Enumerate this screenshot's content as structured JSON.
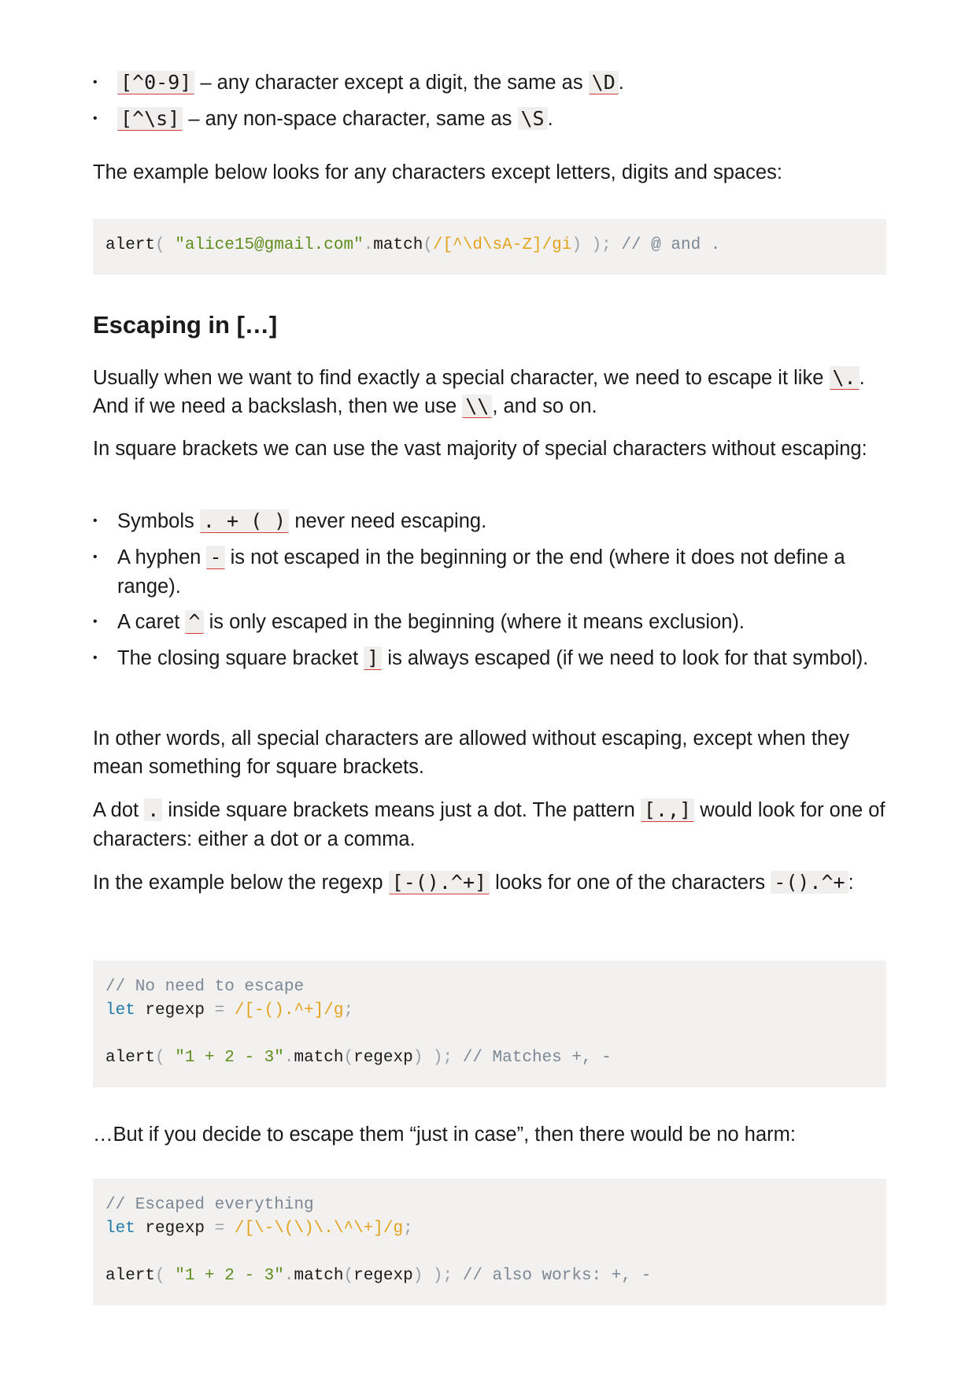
{
  "top_bullets": [
    {
      "code": "[^0-9]",
      "text1": " – any character except a digit, the same as ",
      "code2": "\\D",
      "text2": "."
    },
    {
      "code": "[^\\s]",
      "text1": " – any non-space character, same as ",
      "code2": "\\S",
      "text2": "."
    }
  ],
  "example_intro": "The example below looks for any characters except letters, digits and spaces:",
  "code1": {
    "l1_fn": "alert",
    "l1_p1": "( ",
    "l1_str": "\"alice15@gmail.com\"",
    "l1_dot": ".",
    "l1_m": "match",
    "l1_p2": "(",
    "l1_re": "/[^\\d\\sA-Z]/gi",
    "l1_p3": ") ); ",
    "l1_cm": "// @ and ."
  },
  "heading": "Escaping in […]",
  "para1": {
    "t1": "Usually when we want to find exactly a special character, we need to escape it like ",
    "c1": "\\.",
    "t2": ". And if we need a backslash, then we use ",
    "c2": "\\\\",
    "t3": ", and so on."
  },
  "para2": "In square brackets we can use the vast majority of special characters without escaping:",
  "rules": [
    {
      "t1": "Symbols ",
      "c": ". + ( )",
      "t2": " never need escaping."
    },
    {
      "t1": "A hyphen ",
      "c": "-",
      "t2": " is not escaped in the beginning or the end (where it does not define a range)."
    },
    {
      "t1": "A caret ",
      "c": "^",
      "t2": " is only escaped in the beginning (where it means exclusion)."
    },
    {
      "t1": "The closing square bracket ",
      "c": "]",
      "t2": " is always escaped (if we need to look for that symbol)."
    }
  ],
  "para3": "In other words, all special characters are allowed without escaping, except when they mean something for square brackets.",
  "para4": {
    "t1": "A dot ",
    "c1": ".",
    "t2": " inside square brackets means just a dot. The pattern ",
    "c2": "[.,]",
    "t3": " would look for one of characters: either a dot or a comma."
  },
  "para5": {
    "t1": "In the example below the regexp ",
    "c1": "[-().^+]",
    "t2": " looks for one of the characters ",
    "c2": "-().^+",
    "t3": ":"
  },
  "code2": {
    "comment": "// No need to escape",
    "kw": "let",
    "var": " regexp ",
    "eq": "=",
    "re": " /[-().^+]/g",
    "semi": ";",
    "fn": "alert",
    "p1": "( ",
    "str": "\"1 + 2 - 3\"",
    "dot": ".",
    "m": "match",
    "p2": "(",
    "arg": "regexp",
    "p3": ") ); ",
    "cm": "// Matches +, -"
  },
  "para6": "…But if you decide to escape them “just in case”, then there would be no harm:",
  "code3": {
    "comment": "// Escaped everything",
    "kw": "let",
    "var": " regexp ",
    "eq": "=",
    "re": " /[\\-\\(\\)\\.\\^\\+]/g",
    "semi": ";",
    "fn": "alert",
    "p1": "( ",
    "str": "\"1 + 2 - 3\"",
    "dot": ".",
    "m": "match",
    "p2": "(",
    "arg": "regexp",
    "p3": ") ); ",
    "cm": "// also works: +, -"
  }
}
